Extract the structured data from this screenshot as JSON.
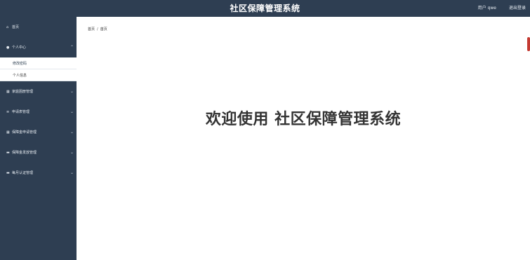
{
  "header": {
    "title": "社区保障管理系统",
    "user_label": "用户 qwe",
    "logout_label": "退出登录"
  },
  "sidebar": {
    "items": [
      {
        "label": "首页",
        "icon": "home-icon"
      },
      {
        "label": "个人中心",
        "icon": "user-icon",
        "expanded": true,
        "children": [
          {
            "label": "修改密码"
          },
          {
            "label": "个人信息"
          }
        ]
      },
      {
        "label": "家庭困册管理",
        "icon": "grid-icon"
      },
      {
        "label": "申请表管理",
        "icon": "list-icon"
      },
      {
        "label": "保障金申请管理",
        "icon": "grid-icon"
      },
      {
        "label": "保障金发放管理",
        "icon": "card-icon"
      },
      {
        "label": "每月认证管理",
        "icon": "card-icon"
      }
    ]
  },
  "breadcrumb": {
    "first": "首页",
    "current": "首页"
  },
  "main": {
    "welcome": "欢迎使用 社区保障管理系统"
  },
  "colors": {
    "header_bg": "#2e3e52",
    "sidebar_bg": "#2e3e52",
    "accent": "#c43a32"
  }
}
